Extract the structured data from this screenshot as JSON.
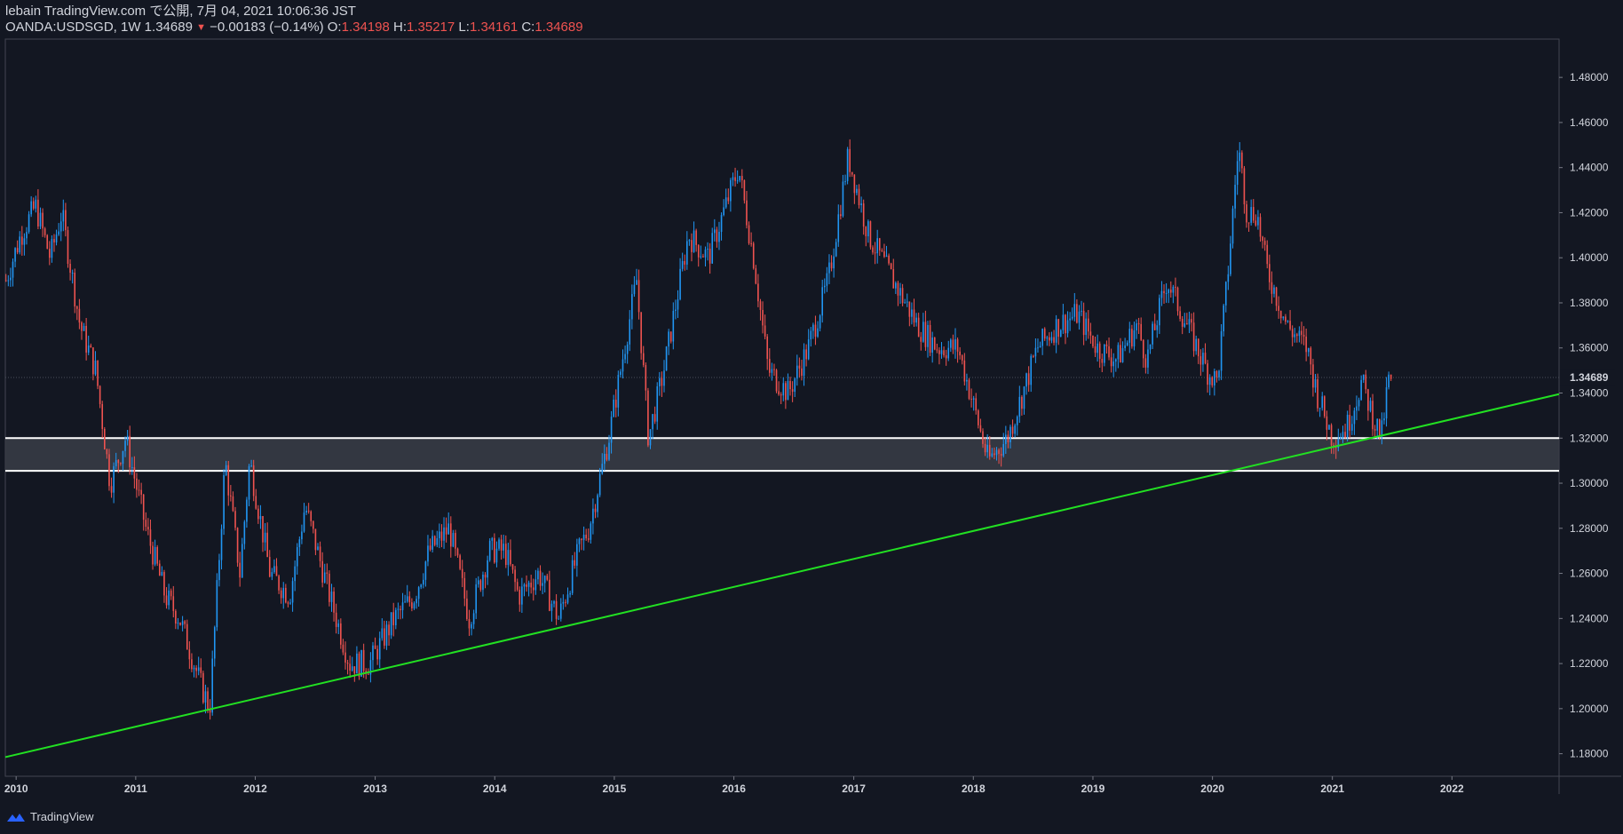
{
  "header": {
    "line1": "lebain TradingView.com で公開, 7月 04, 2021 10:06:36 JST",
    "symbol": "OANDA:USDSGD, 1W 1.34689",
    "arrow": "▼",
    "change": "−0.00183 (−0.14%)",
    "o_label": "O:",
    "o_value": "1.34198",
    "h_label": "H:",
    "h_value": "1.35217",
    "l_label": "L:",
    "l_value": "1.34161",
    "c_label": "C:",
    "c_value": "1.34689"
  },
  "footer": {
    "brand": "TradingView",
    "logo_icon": "tradingview-logo-icon"
  },
  "colors": {
    "background": "#131722",
    "up": "#2196f3",
    "down": "#ef5350",
    "trendline": "#22e022",
    "zone_fill": "#3a3d46",
    "zone_line": "#ffffff"
  },
  "chart_data": {
    "type": "candlestick",
    "title": "OANDA:USDSGD, 1W",
    "x_range": [
      "2009-11-29",
      "2022-11-24"
    ],
    "ylim": [
      1.17,
      1.497
    ],
    "x_tick_labels": [
      "2010",
      "2011",
      "2012",
      "2013",
      "2014",
      "2015",
      "2016",
      "2017",
      "2018",
      "2019",
      "2020",
      "2021",
      "2022"
    ],
    "y_tick_labels": [
      "1.18000",
      "1.20000",
      "1.22000",
      "1.24000",
      "1.26000",
      "1.28000",
      "1.30000",
      "1.32000",
      "1.34000",
      "1.36000",
      "1.38000",
      "1.40000",
      "1.42000",
      "1.44000",
      "1.46000",
      "1.48000"
    ],
    "last_price_label": "1.34689",
    "last_price": 1.34689,
    "price_path": [
      {
        "date": "2009-12-01",
        "close": 1.39
      },
      {
        "date": "2010-01-15",
        "close": 1.41
      },
      {
        "date": "2010-03-01",
        "close": 1.423
      },
      {
        "date": "2010-04-15",
        "close": 1.4
      },
      {
        "date": "2010-05-20",
        "close": 1.42
      },
      {
        "date": "2010-07-15",
        "close": 1.37
      },
      {
        "date": "2010-09-01",
        "close": 1.35
      },
      {
        "date": "2010-10-15",
        "close": 1.3
      },
      {
        "date": "2010-12-01",
        "close": 1.32
      },
      {
        "date": "2011-02-01",
        "close": 1.28
      },
      {
        "date": "2011-04-01",
        "close": 1.25
      },
      {
        "date": "2011-05-15",
        "close": 1.24
      },
      {
        "date": "2011-07-20",
        "close": 1.21
      },
      {
        "date": "2011-08-15",
        "close": 1.2
      },
      {
        "date": "2011-10-01",
        "close": 1.31
      },
      {
        "date": "2011-11-15",
        "close": 1.26
      },
      {
        "date": "2011-12-15",
        "close": 1.31
      },
      {
        "date": "2012-02-15",
        "close": 1.26
      },
      {
        "date": "2012-04-15",
        "close": 1.25
      },
      {
        "date": "2012-06-01",
        "close": 1.29
      },
      {
        "date": "2012-08-15",
        "close": 1.25
      },
      {
        "date": "2012-10-15",
        "close": 1.22
      },
      {
        "date": "2012-12-15",
        "close": 1.22
      },
      {
        "date": "2013-03-01",
        "close": 1.24
      },
      {
        "date": "2013-05-01",
        "close": 1.25
      },
      {
        "date": "2013-06-15",
        "close": 1.27
      },
      {
        "date": "2013-08-15",
        "close": 1.28
      },
      {
        "date": "2013-10-15",
        "close": 1.24
      },
      {
        "date": "2013-12-15",
        "close": 1.27
      },
      {
        "date": "2014-02-01",
        "close": 1.27
      },
      {
        "date": "2014-03-15",
        "close": 1.25
      },
      {
        "date": "2014-05-15",
        "close": 1.26
      },
      {
        "date": "2014-07-15",
        "close": 1.24
      },
      {
        "date": "2014-09-15",
        "close": 1.27
      },
      {
        "date": "2014-10-15",
        "close": 1.28
      },
      {
        "date": "2014-12-15",
        "close": 1.32
      },
      {
        "date": "2015-02-01",
        "close": 1.36
      },
      {
        "date": "2015-03-10",
        "close": 1.39
      },
      {
        "date": "2015-04-15",
        "close": 1.32
      },
      {
        "date": "2015-06-01",
        "close": 1.35
      },
      {
        "date": "2015-08-15",
        "close": 1.41
      },
      {
        "date": "2015-10-15",
        "close": 1.4
      },
      {
        "date": "2016-01-15",
        "close": 1.44
      },
      {
        "date": "2016-03-01",
        "close": 1.4
      },
      {
        "date": "2016-04-15",
        "close": 1.35
      },
      {
        "date": "2016-06-15",
        "close": 1.34
      },
      {
        "date": "2016-08-15",
        "close": 1.36
      },
      {
        "date": "2016-10-15",
        "close": 1.39
      },
      {
        "date": "2016-12-15",
        "close": 1.445
      },
      {
        "date": "2017-02-15",
        "close": 1.41
      },
      {
        "date": "2017-05-01",
        "close": 1.39
      },
      {
        "date": "2017-07-15",
        "close": 1.37
      },
      {
        "date": "2017-09-15",
        "close": 1.36
      },
      {
        "date": "2017-11-15",
        "close": 1.36
      },
      {
        "date": "2018-01-10",
        "close": 1.33
      },
      {
        "date": "2018-02-15",
        "close": 1.31
      },
      {
        "date": "2018-04-15",
        "close": 1.32
      },
      {
        "date": "2018-06-01",
        "close": 1.34
      },
      {
        "date": "2018-07-15",
        "close": 1.36
      },
      {
        "date": "2018-09-15",
        "close": 1.37
      },
      {
        "date": "2018-11-15",
        "close": 1.375
      },
      {
        "date": "2019-01-15",
        "close": 1.36
      },
      {
        "date": "2019-03-15",
        "close": 1.355
      },
      {
        "date": "2019-05-15",
        "close": 1.37
      },
      {
        "date": "2019-06-15",
        "close": 1.355
      },
      {
        "date": "2019-08-15",
        "close": 1.39
      },
      {
        "date": "2019-10-15",
        "close": 1.37
      },
      {
        "date": "2019-12-15",
        "close": 1.35
      },
      {
        "date": "2020-01-15",
        "close": 1.345
      },
      {
        "date": "2020-02-15",
        "close": 1.39
      },
      {
        "date": "2020-03-20",
        "close": 1.45
      },
      {
        "date": "2020-04-15",
        "close": 1.42
      },
      {
        "date": "2020-05-15",
        "close": 1.42
      },
      {
        "date": "2020-06-15",
        "close": 1.395
      },
      {
        "date": "2020-08-15",
        "close": 1.37
      },
      {
        "date": "2020-10-15",
        "close": 1.36
      },
      {
        "date": "2020-11-15",
        "close": 1.34
      },
      {
        "date": "2021-01-01",
        "close": 1.32
      },
      {
        "date": "2021-02-15",
        "close": 1.325
      },
      {
        "date": "2021-03-31",
        "close": 1.345
      },
      {
        "date": "2021-05-15",
        "close": 1.325
      },
      {
        "date": "2021-06-01",
        "close": 1.322
      },
      {
        "date": "2021-06-20",
        "close": 1.345
      },
      {
        "date": "2021-07-04",
        "close": 1.3469
      }
    ],
    "support_zone": {
      "upper": 1.32,
      "lower": 1.3055
    },
    "trendline": {
      "from": {
        "date": "2009-11-29",
        "price": 1.1785
      },
      "to": {
        "date": "2022-11-24",
        "price": 1.3395
      }
    }
  }
}
